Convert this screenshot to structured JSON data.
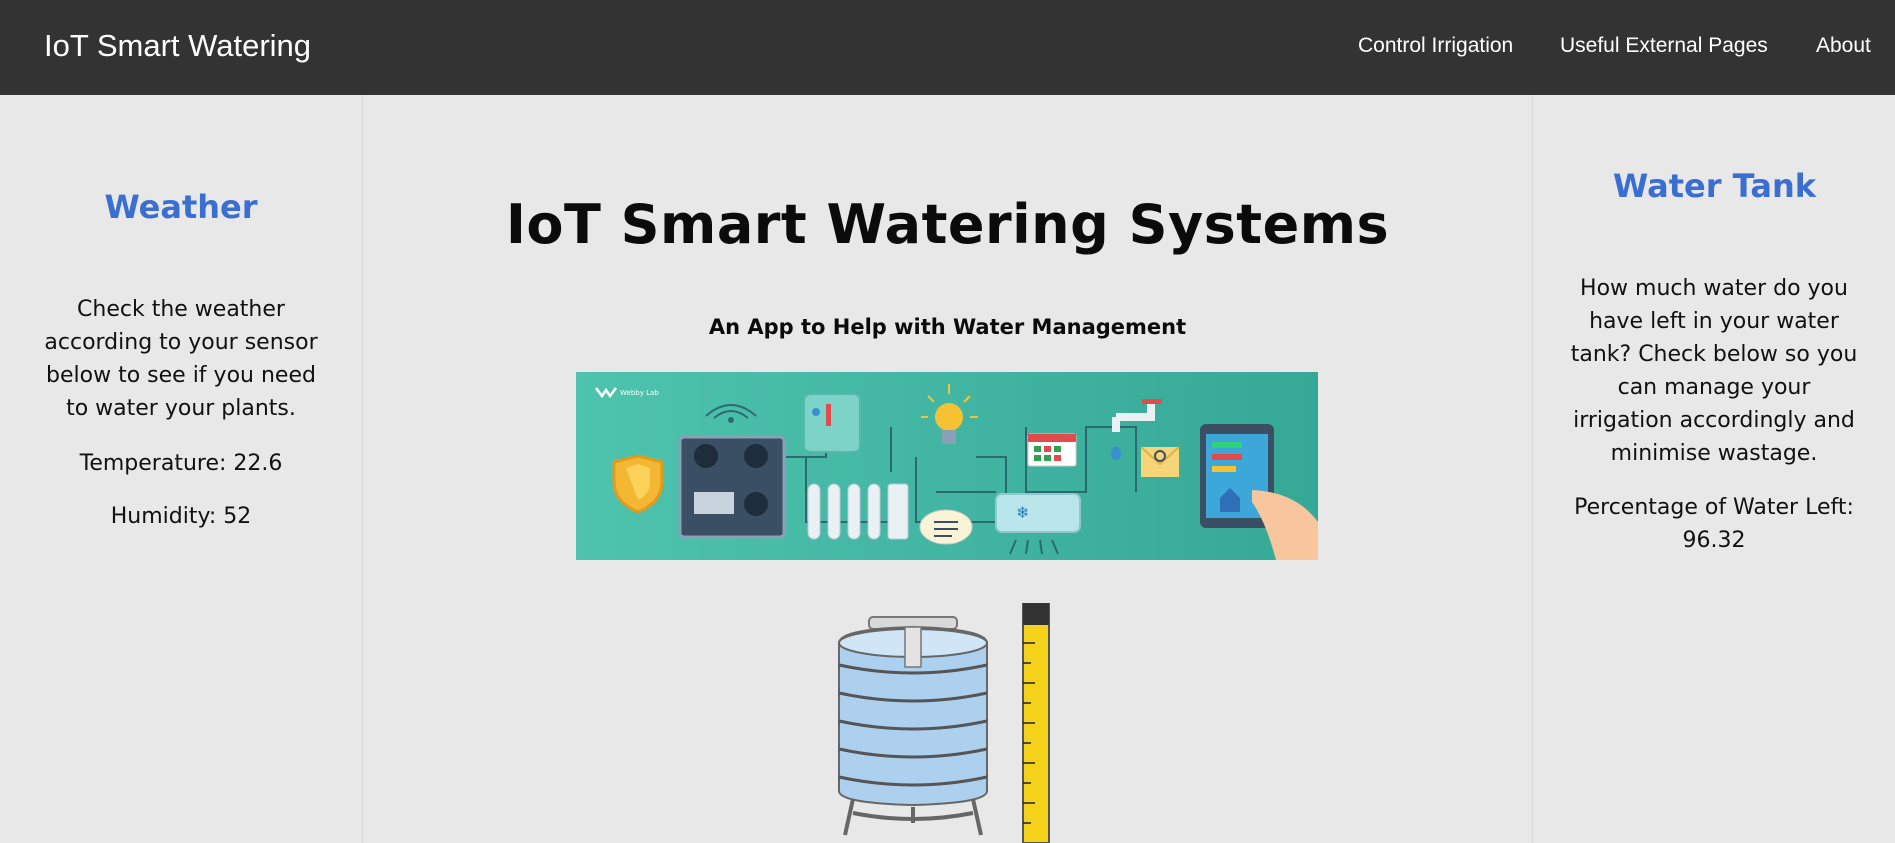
{
  "navbar": {
    "brand": "IoT Smart Watering",
    "links": [
      "Control Irrigation",
      "Useful External Pages",
      "About"
    ]
  },
  "weather": {
    "title": "Weather",
    "description_lines": [
      "Check the weather",
      "according to your sensor",
      "below to see if you need",
      "to water your plants."
    ],
    "temperature": "Temperature: 22.6",
    "humidity": "Humidity: 52"
  },
  "main": {
    "title": "IoT Smart Watering Systems",
    "subtitle": "An App to Help with Water Management",
    "banner_logo": "Webby Lab"
  },
  "water_tank": {
    "title": "Water Tank",
    "description_lines": [
      "How much water do you",
      "have left in your water",
      "tank? Check below so you",
      "can manage your",
      "irrigation accordingly and",
      "minimise wastage."
    ],
    "percentage_label": "Percentage of Water Left:",
    "percentage_value": "96.32"
  },
  "colors": {
    "navbar": "#333333",
    "accent": "#3a6fd1",
    "background": "#e8e8e8",
    "banner": "#45bba6"
  },
  "icons": [
    "shield-icon",
    "sensor-panel-icon",
    "wifi-icon",
    "thermometer-icon",
    "lightbulb-icon",
    "radiator-icon",
    "chat-icon",
    "air-conditioner-icon",
    "calendar-icon",
    "faucet-icon",
    "email-icon",
    "tablet-icon",
    "water-tank-icon",
    "measuring-tape-icon"
  ]
}
